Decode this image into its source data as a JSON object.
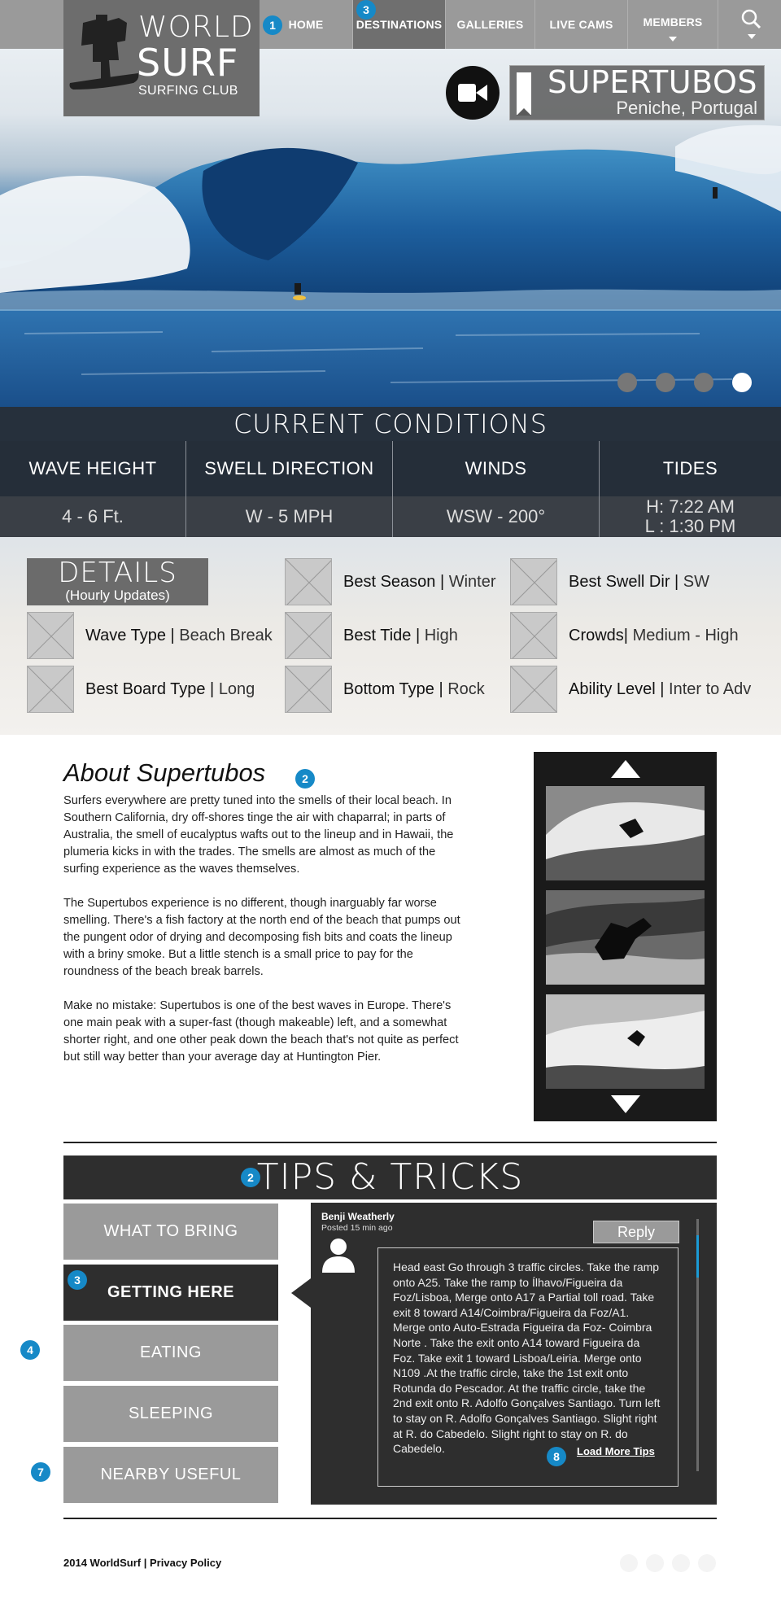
{
  "nav": {
    "items": [
      {
        "label": "HOME",
        "active": false,
        "dropdown": false
      },
      {
        "label": "DESTINATIONS",
        "active": true,
        "dropdown": false
      },
      {
        "label": "GALLERIES",
        "active": false,
        "dropdown": false
      },
      {
        "label": "LIVE CAMS",
        "active": false,
        "dropdown": false
      },
      {
        "label": "MEMBERS",
        "active": false,
        "dropdown": true
      }
    ],
    "search_icon": "magnifier-icon"
  },
  "logo": {
    "line1": "WORLD",
    "line2": "SURF",
    "line3": "SURFING CLUB",
    "icon": "surfer-logo-icon"
  },
  "hero": {
    "spot_title": "SUPERTUBOS",
    "spot_location": "Peniche, Portugal",
    "camera_icon": "video-camera-icon",
    "bookmark_icon": "bookmark-icon",
    "slides_total": 4,
    "active_slide": 4
  },
  "conditions": {
    "title": "CURRENT CONDITIONS",
    "columns": [
      {
        "label": "WAVE HEIGHT",
        "value": "4 - 6 Ft."
      },
      {
        "label": "SWELL DIRECTION",
        "value": "W - 5 MPH"
      },
      {
        "label": "WINDS",
        "value": "WSW - 200°"
      },
      {
        "label": "TIDES",
        "value": "H: 7:22 AM\nL : 1:30 PM"
      }
    ]
  },
  "details": {
    "title": "DETAILS",
    "subtitle": "(Hourly Updates)",
    "items": [
      {
        "label": "Best Season",
        "value": "Winter"
      },
      {
        "label": "Best Swell Dir",
        "value": "SW"
      },
      {
        "label": "Wave Type",
        "value": "Beach Break"
      },
      {
        "label": "Best Tide",
        "value": "High"
      },
      {
        "label": "Crowds",
        "value": "Medium - High"
      },
      {
        "label": "Best Board Type",
        "value": "Long"
      },
      {
        "label": "Bottom Type",
        "value": "Rock"
      },
      {
        "label": "Ability Level",
        "value": "Inter to Adv"
      }
    ]
  },
  "about": {
    "title": "About Supertubos",
    "paragraphs": [
      "Surfers everywhere are pretty tuned into the smells of their local beach. In Southern California, dry off-shores tinge the air with chaparral; in parts of Australia, the smell of eucalyptus wafts out to the lineup and in Hawaii, the plumeria kicks in with the trades. The smells are almost as much of the surfing experience as the waves themselves.",
      "The Supertubos experience is no different, though inarguably far worse smelling. There's a fish factory at the north end of the beach that pumps out the pungent odor of drying and decomposing fish bits and coats the lineup with a briny smoke. But a little stench is a small price to pay for the roundness of the beach break barrels.",
      "Make no mistake: Supertubos is one of the best waves in Europe. There's one main peak with a super-fast (though makeable) left, and a somewhat shorter right, and one other peak down the beach that's not quite as perfect but still way better than your average day at Huntington Pier."
    ]
  },
  "tips": {
    "title": "TIPS & TRICKS",
    "tabs": [
      {
        "label": "WHAT TO BRING",
        "active": false
      },
      {
        "label": "GETTING HERE",
        "active": true
      },
      {
        "label": "EATING",
        "active": false
      },
      {
        "label": "SLEEPING",
        "active": false
      },
      {
        "label": "NEARBY USEFUL",
        "active": false
      }
    ],
    "comment": {
      "author": "Benji Weatherly",
      "posted": "Posted 15 min ago",
      "reply_label": "Reply",
      "text": "Head east Go through 3 traffic circles. Take the ramp onto A25. Take the ramp to Ílhavo/Figueira da Foz/Lisboa, Merge onto A17 a Partial toll road. Take exit 8 toward A14/Coimbra/Figueira da Foz/A1. Merge onto Auto-Estrada Figueira da Foz- Coimbra Norte . Take the exit onto A14 toward Figueira da Foz. Take exit 1 toward Lisboa/Leiria. Merge onto N109 .At the traffic circle, take the 1st exit onto Rotunda do Pescador. At the traffic circle, take the 2nd exit onto R. Adolfo Gonçalves Santiago. Turn left to stay on R. Adolfo Gonçalves Santiago. Slight right at R. do Cabedelo. Slight right to stay on R. do Cabedelo.",
      "load_more": "Load More Tips"
    }
  },
  "footer": {
    "copyright": "2014 WorldSurf",
    "separator": "|",
    "privacy": "Privacy Policy"
  },
  "badges": [
    "1",
    "3",
    "2",
    "2",
    "3",
    "4",
    "7",
    "8"
  ]
}
